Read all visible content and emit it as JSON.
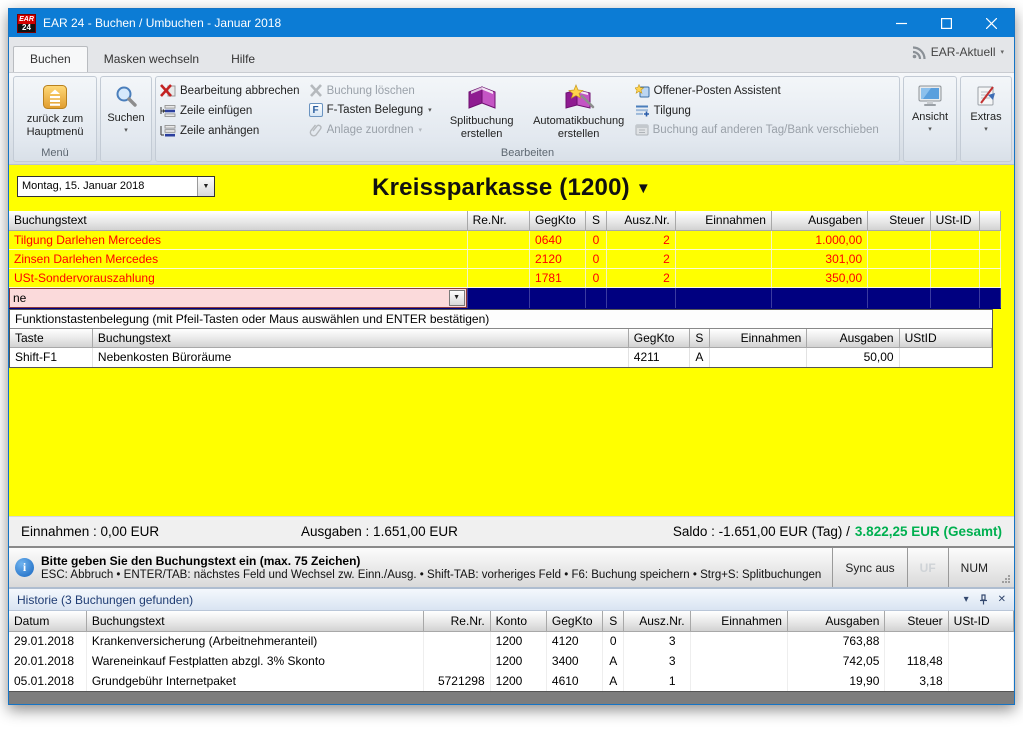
{
  "colors": {
    "titlebar": "#0c7cd5",
    "grid_yellow": "#ffff00",
    "selection_navy": "#000080",
    "grid_text_red": "#ff0000",
    "saldo_green": "#00b050",
    "input_pink": "#fbdadb"
  },
  "icons": {
    "f_key": "F",
    "info": "i",
    "caret": "▼",
    "caret_small": "▾",
    "close": "✕"
  },
  "titlebar": {
    "title": "EAR 24 - Buchen / Umbuchen - Januar 2018",
    "logo_top": "EAR",
    "logo_bottom": "24"
  },
  "tabs": {
    "buchen": "Buchen",
    "masken": "Masken wechseln",
    "hilfe": "Hilfe",
    "ear_aktuell": "EAR-Aktuell"
  },
  "ribbon": {
    "menu": {
      "button": "zurück zum Hauptmenü",
      "group_label": "Menü"
    },
    "suchen": {
      "button": "Suchen"
    },
    "bearbeiten": {
      "group_label": "Bearbeiten",
      "abbrechen": "Bearbeitung abbrechen",
      "zeile_einfuegen": "Zeile einfügen",
      "zeile_anhaengen": "Zeile anhängen",
      "loeschen": "Buchung löschen",
      "ftasten": "F-Tasten Belegung",
      "anlage": "Anlage zuordnen",
      "split": "Splitbuchung erstellen",
      "automatik": "Automatikbuchung erstellen",
      "offener_posten": "Offener-Posten Assistent",
      "tilgung": "Tilgung",
      "verschieben": "Buchung auf anderen Tag/Bank verschieben"
    },
    "ansicht": "Ansicht",
    "extras": "Extras"
  },
  "header": {
    "date": "Montag, 15. Januar 2018",
    "account": "Kreissparkasse (1200)"
  },
  "grid": {
    "columns": [
      "Buchungstext",
      "Re.Nr.",
      "GegKto",
      "S",
      "Ausz.Nr.",
      "Einnahmen",
      "Ausgaben",
      "Steuer",
      "USt-ID"
    ],
    "rows": [
      {
        "text": "Tilgung Darlehen Mercedes",
        "renr": "",
        "gegkto": "0640",
        "s": "0",
        "ausznr": "2",
        "einnahmen": "",
        "ausgaben": "1.000,00",
        "steuer": "",
        "ustid": ""
      },
      {
        "text": "Zinsen Darlehen Mercedes",
        "renr": "",
        "gegkto": "2120",
        "s": "0",
        "ausznr": "2",
        "einnahmen": "",
        "ausgaben": "301,00",
        "steuer": "",
        "ustid": ""
      },
      {
        "text": "USt-Sondervorauszahlung",
        "renr": "",
        "gegkto": "1781",
        "s": "0",
        "ausznr": "2",
        "einnahmen": "",
        "ausgaben": "350,00",
        "steuer": "",
        "ustid": ""
      }
    ],
    "input_value": "ne"
  },
  "fkeys": {
    "title": "Funktionstastenbelegung (mit Pfeil-Tasten oder Maus auswählen und ENTER bestätigen)",
    "columns": [
      "Taste",
      "Buchungstext",
      "GegKto",
      "S",
      "Einnahmen",
      "Ausgaben",
      "UStID"
    ],
    "row": {
      "taste": "Shift-F1",
      "text": "Nebenkosten Büroräume",
      "gegkto": "4211",
      "s": "A",
      "einnahmen": "",
      "ausgaben": "50,00",
      "ustid": ""
    }
  },
  "summary": {
    "einnahmen": "Einnahmen : 0,00 EUR",
    "ausgaben": "Ausgaben : 1.651,00 EUR",
    "saldo_tag": "Saldo : -1.651,00 EUR (Tag) /",
    "saldo_gesamt": "3.822,25 EUR (Gesamt)"
  },
  "statusbar": {
    "line1": "Bitte geben Sie den Buchungstext ein (max. 75 Zeichen)",
    "line2": "ESC: Abbruch • ENTER/TAB: nächstes Feld und Wechsel zw. Einn./Ausg. • Shift-TAB: vorheriges Feld • F6: Buchung speichern • Strg+S: Splitbuchungen",
    "sync": "Sync aus",
    "uf": "UF",
    "num": "NUM"
  },
  "history": {
    "title": "Historie (3 Buchungen gefunden)",
    "columns": [
      "Datum",
      "Buchungstext",
      "Re.Nr.",
      "Konto",
      "GegKto",
      "S",
      "Ausz.Nr.",
      "Einnahmen",
      "Ausgaben",
      "Steuer",
      "USt-ID"
    ],
    "rows": [
      {
        "datum": "29.01.2018",
        "text": "Krankenversicherung (Arbeitnehmeranteil)",
        "renr": "",
        "konto": "1200",
        "gegkto": "4120",
        "s": "0",
        "ausznr": "3",
        "einnahmen": "",
        "ausgaben": "763,88",
        "steuer": "",
        "ustid": ""
      },
      {
        "datum": "20.01.2018",
        "text": "Wareneinkauf Festplatten abzgl. 3% Skonto",
        "renr": "",
        "konto": "1200",
        "gegkto": "3400",
        "s": "A",
        "ausznr": "3",
        "einnahmen": "",
        "ausgaben": "742,05",
        "steuer": "118,48",
        "ustid": ""
      },
      {
        "datum": "05.01.2018",
        "text": "Grundgebühr Internetpaket",
        "renr": "5721298",
        "konto": "1200",
        "gegkto": "4610",
        "s": "A",
        "ausznr": "1",
        "einnahmen": "",
        "ausgaben": "19,90",
        "steuer": "3,18",
        "ustid": ""
      }
    ]
  }
}
